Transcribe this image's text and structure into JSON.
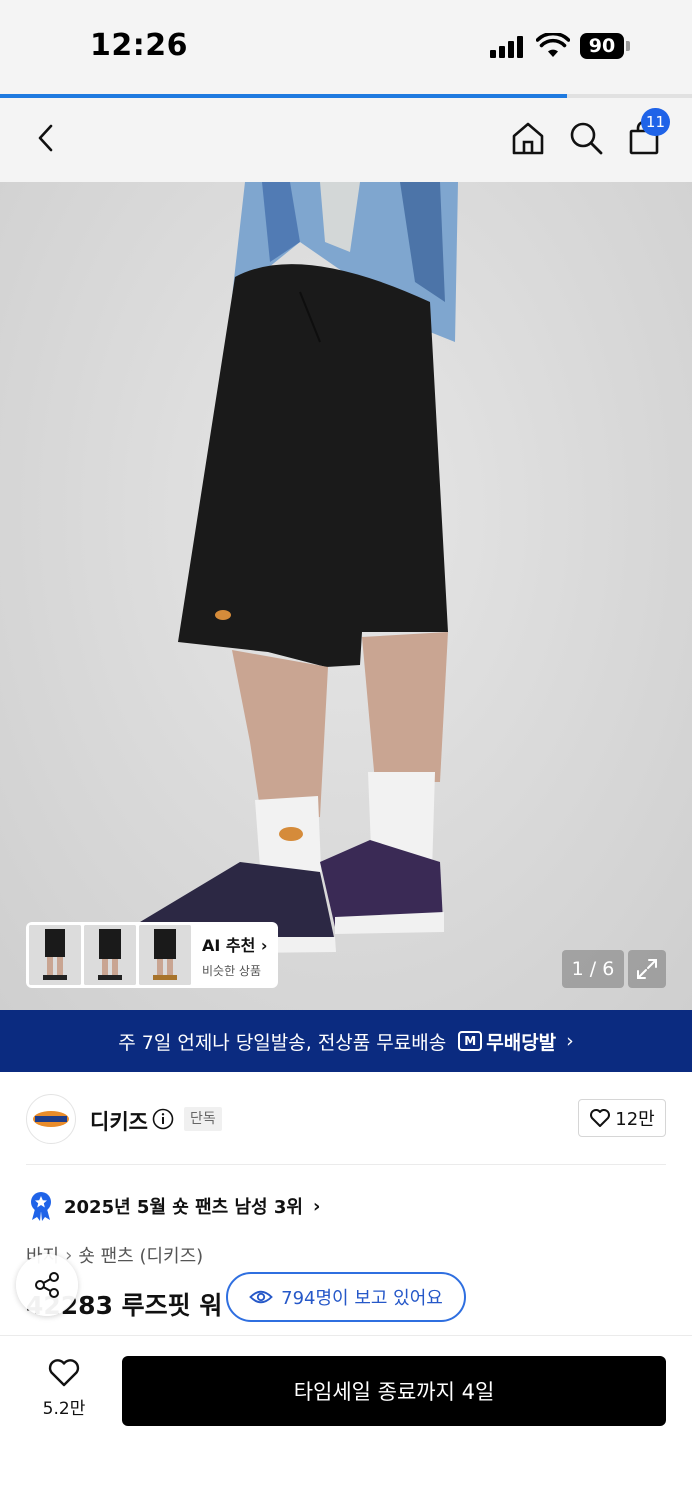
{
  "status_bar": {
    "time": "12:26",
    "battery": "90"
  },
  "load_progress": 0.82,
  "nav": {
    "back_icon": "chevron-left-icon",
    "home_icon": "home-icon",
    "search_icon": "search-icon",
    "cart_icon": "shopping-bag-icon",
    "cart_badge": "11"
  },
  "gallery": {
    "ai_title": "AI 추천",
    "ai_subtitle": "비슷한 상품",
    "page_counter": "1 / 6",
    "current_page": 1,
    "total_pages": 6
  },
  "promo": {
    "text": "주 7일 언제나 당일발송, 전상품 무료배송",
    "logo_mark": "M",
    "logo_text": "무배당발"
  },
  "brand": {
    "name": "디키즈",
    "badge": "단독",
    "likes": "12만"
  },
  "ranking": {
    "text": "2025년 5월 숏 팬츠 남성 3위"
  },
  "breadcrumb": {
    "parent": "바지",
    "current": "숏 팬츠 (디키즈)"
  },
  "product": {
    "title": "42283 루즈핏 워"
  },
  "viewers": {
    "text": "794명이 보고 있어요"
  },
  "bottom": {
    "wish_count": "5.2만",
    "buy_label": "타임세일 종료까지 4일"
  },
  "colors": {
    "accent": "#1f63e8",
    "promo_bg": "#0b2b80",
    "buy_bg": "#000000"
  }
}
